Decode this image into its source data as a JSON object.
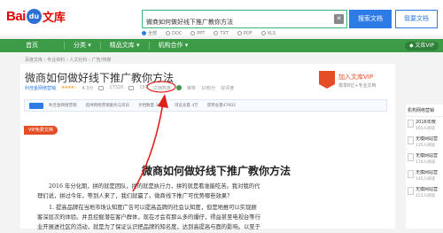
{
  "header": {
    "logo_bai": "Bai",
    "logo_paw": "du",
    "logo_wenku": "文库",
    "search_value": "微商如何做好线下推广教你方法",
    "search_button": "搜索文档",
    "upload_button": "我要文档"
  },
  "filters": [
    "全部",
    "DOC",
    "PPT",
    "TXT",
    "PDF",
    "XLS"
  ],
  "nav": {
    "items": [
      "首页",
      "分类",
      "精品文库",
      "机构合作"
    ],
    "vip": "文库VIP"
  },
  "breadcrumb": "百度文库 › 专业资料 › 人文社科 › 广告/传媒",
  "document": {
    "title": "微商如何做好线下推广教你方法",
    "author": "利佳金网络营销",
    "rating": "4.3分",
    "views": "17320",
    "downloads": "157",
    "pages": "文档热度",
    "status": "审核",
    "reward": "10积分",
    "size": "好评度"
  },
  "vip_ad": {
    "title": "加入文库VIP",
    "subtitle": "尊享8亿+专业文档"
  },
  "infobar": {
    "company": "利佳金网络营销",
    "items": [
      "提供网络营销服务与资讯",
      "文档数量 3000",
      "浏览总量 4万",
      "获赞总量47602"
    ]
  },
  "vip_free": "VIP免费文档",
  "article": {
    "title": "微商如何做好线下推广教你方法",
    "paragraphs": [
      "2016 年分化期，拼的就是团队，拼的就是执行力，拼的就是看谁能吃苦。我对我的代",
      "理们说，拼过今年，等到人来了，我们就赢了。微商线下推广可优势哪些效果？",
      "1. 提高品牌在当地市场认知度广告可以提高品牌的社会认知度，但是地推可以实现顾",
      "客深层次的体验。并且挖掘潜在客户群体，现在才会有那么多的爆仔，得益甚至电视台等行",
      "业开展进社区的活动，就是为了保证认识把品牌的知名度，达到高提高与面的影响。以至于"
    ]
  },
  "sidebar": {
    "head": "机构网络营销",
    "items": [
      {
        "title": "2016年微",
        "sub": "165人阅读"
      },
      {
        "title": "无模网站营",
        "sub": "135人阅读"
      },
      {
        "title": "无模网站营",
        "sub": "174人阅读"
      },
      {
        "title": "无模网站营",
        "sub": "145人阅读"
      },
      {
        "title": "无模网站营",
        "sub": "151人阅读"
      }
    ]
  },
  "colors": {
    "nav_green": "#3c9b46",
    "link_blue": "#2d7be5",
    "accent_red": "#e10602",
    "vip_orange": "#e54d26"
  }
}
